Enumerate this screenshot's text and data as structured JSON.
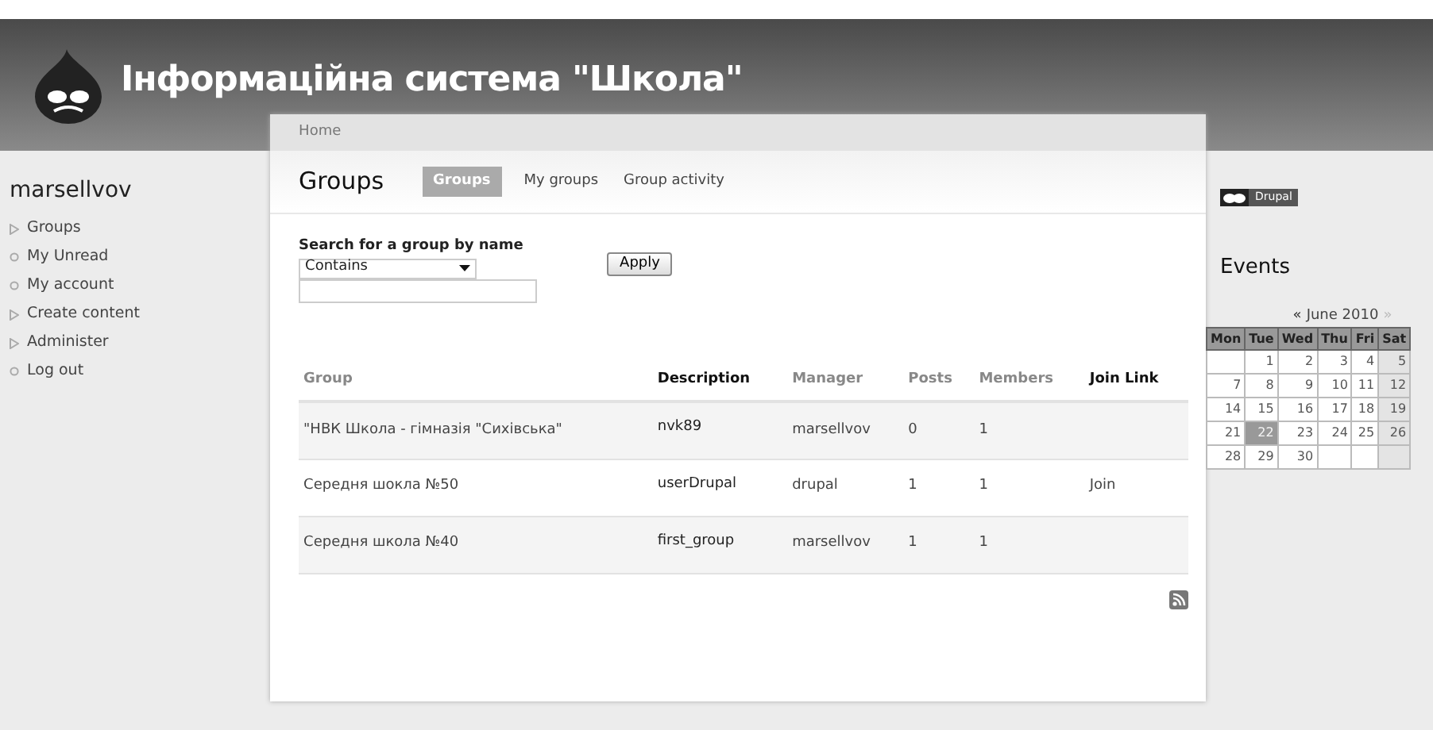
{
  "header": {
    "site_name": "Інформаційна система \"Школа\""
  },
  "breadcrumb": "Home",
  "sidebar": {
    "title": "marsellvov",
    "items": [
      {
        "label": "Groups",
        "kind": "expandable"
      },
      {
        "label": "My Unread",
        "kind": "leaf"
      },
      {
        "label": "My account",
        "kind": "leaf"
      },
      {
        "label": "Create content",
        "kind": "expandable"
      },
      {
        "label": "Administer",
        "kind": "expandable"
      },
      {
        "label": "Log out",
        "kind": "leaf"
      }
    ]
  },
  "page": {
    "title": "Groups",
    "tabs": [
      {
        "label": "Groups",
        "selected": true
      },
      {
        "label": "My groups",
        "selected": false
      },
      {
        "label": "Group activity",
        "selected": false
      }
    ]
  },
  "search": {
    "label": "Search for a group by name",
    "operator": "Contains",
    "button": "Apply"
  },
  "table": {
    "columns": [
      {
        "label": "Group",
        "sortable": true
      },
      {
        "label": "Description",
        "sortable": false
      },
      {
        "label": "Manager",
        "sortable": true
      },
      {
        "label": "Posts",
        "sortable": true
      },
      {
        "label": "Members",
        "sortable": true
      },
      {
        "label": "Join Link",
        "sortable": false
      }
    ],
    "rows": [
      {
        "group": "\"НВК Школа - гімназія \"Сихівська\"",
        "description": "nvk89",
        "manager": "marsellvov",
        "posts": "0",
        "members": "1"
      },
      {
        "group": "Середня шокла №50",
        "description": "userDrupal",
        "manager": "drupal",
        "posts": "1",
        "members": "1",
        "join_link": "Join"
      },
      {
        "group": "Середня школа №40",
        "description": "first_group",
        "manager": "marsellvov",
        "posts": "1",
        "members": "1"
      }
    ]
  },
  "powered_by": "Drupal",
  "events": {
    "title": "Events",
    "month": "June 2010",
    "prev": "«",
    "next": "»",
    "weekdays": [
      "Mon",
      "Tue",
      "Wed",
      "Thu",
      "Fri",
      "Sat"
    ],
    "weeks": [
      [
        {
          "kind": "blank"
        },
        {
          "kind": "day",
          "day": "1",
          "selected": false
        },
        {
          "kind": "day",
          "day": "2",
          "selected": false
        },
        {
          "kind": "day",
          "day": "3",
          "selected": false
        },
        {
          "kind": "day",
          "day": "4",
          "selected": false
        },
        {
          "kind": "day",
          "day": "5",
          "selected": false
        }
      ],
      [
        {
          "kind": "day",
          "day": "7",
          "selected": false
        },
        {
          "kind": "day",
          "day": "8",
          "selected": false
        },
        {
          "kind": "day",
          "day": "9",
          "selected": false
        },
        {
          "kind": "day",
          "day": "10",
          "selected": false
        },
        {
          "kind": "day",
          "day": "11",
          "selected": false
        },
        {
          "kind": "day",
          "day": "12",
          "selected": false
        }
      ],
      [
        {
          "kind": "day",
          "day": "14",
          "selected": false
        },
        {
          "kind": "day",
          "day": "15",
          "selected": false
        },
        {
          "kind": "day",
          "day": "16",
          "selected": false
        },
        {
          "kind": "day",
          "day": "17",
          "selected": false
        },
        {
          "kind": "day",
          "day": "18",
          "selected": false
        },
        {
          "kind": "day",
          "day": "19",
          "selected": false
        }
      ],
      [
        {
          "kind": "day",
          "day": "21",
          "selected": false
        },
        {
          "kind": "day",
          "day": "22",
          "selected": true
        },
        {
          "kind": "day",
          "day": "23",
          "selected": false
        },
        {
          "kind": "day",
          "day": "24",
          "selected": false
        },
        {
          "kind": "day",
          "day": "25",
          "selected": false
        },
        {
          "kind": "day",
          "day": "26",
          "selected": false
        }
      ],
      [
        {
          "kind": "day",
          "day": "28",
          "selected": false
        },
        {
          "kind": "day",
          "day": "29",
          "selected": false
        },
        {
          "kind": "day",
          "day": "30",
          "selected": false
        },
        {
          "kind": "blank"
        },
        {
          "kind": "blank"
        },
        {
          "kind": "blank"
        }
      ]
    ]
  }
}
